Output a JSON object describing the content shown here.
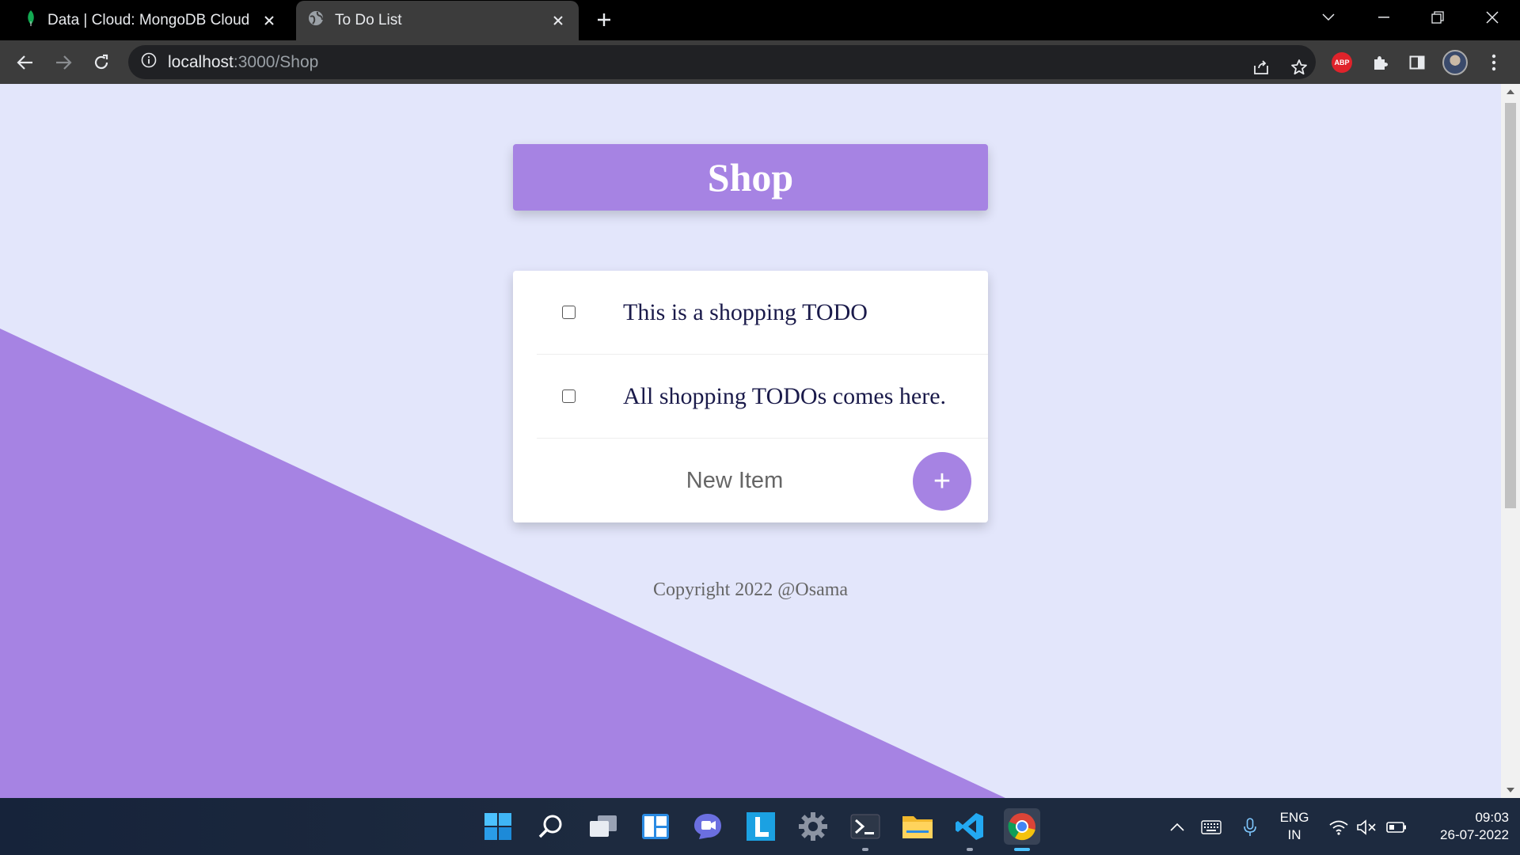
{
  "browser": {
    "tabs": [
      {
        "title": "Data | Cloud: MongoDB Cloud",
        "icon": "mongodb-leaf-icon",
        "active": false
      },
      {
        "title": "To Do List",
        "icon": "globe-icon",
        "active": true
      }
    ],
    "url": {
      "host": "localhost",
      "path": ":3000/Shop"
    }
  },
  "page": {
    "title": "Shop",
    "items": [
      {
        "text": "This is a shopping TODO",
        "checked": false
      },
      {
        "text": "All shopping TODOs comes here.",
        "checked": false
      }
    ],
    "new_item_placeholder": "New Item",
    "add_label": "+",
    "footer": "Copyright 2022 @Osama"
  },
  "colors": {
    "accent": "#a683e3",
    "page_background": "#e3e6fb"
  },
  "taskbar": {
    "language": "ENG",
    "region": "IN",
    "time": "09:03",
    "date": "26-07-2022"
  }
}
